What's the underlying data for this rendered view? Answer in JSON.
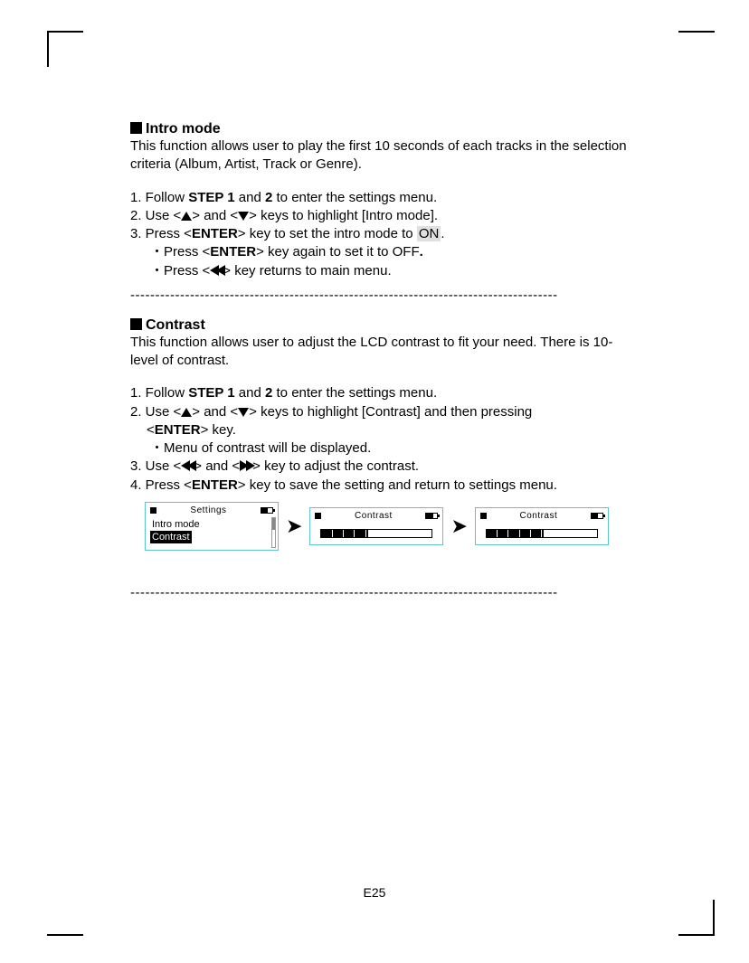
{
  "section1": {
    "heading": "Intro mode",
    "desc": "This function allows user to play the first 10 seconds of each tracks in the selection criteria (Album, Artist, Track or Genre).",
    "step1_a": "1. Follow ",
    "step1_b": "STEP 1",
    "step1_c": " and ",
    "step1_d": "2",
    "step1_e": " to enter the settings menu.",
    "step2_a": "2. Use <",
    "step2_b": "> and <",
    "step2_c": "> keys to highlight [Intro mode].",
    "step3_a": "3. Press <",
    "step3_b": "ENTER",
    "step3_c": "> key to set the intro mode to ",
    "step3_d": "ON",
    "step3_e": ".",
    "sub1_a": "・Press <",
    "sub1_b": "ENTER",
    "sub1_c": "> key again to set it to OFF",
    "sub1_d": ".",
    "sub2_a": "・Press <",
    "sub2_b": "> key returns to main menu."
  },
  "section2": {
    "heading": "Contrast",
    "desc": "This function allows user to adjust the LCD contrast to fit your need. There is 10-level of contrast.",
    "step1_a": "1. Follow ",
    "step1_b": "STEP 1",
    "step1_c": " and ",
    "step1_d": "2",
    "step1_e": " to enter the settings menu.",
    "step2_a": "2. Use <",
    "step2_b": "> and <",
    "step2_c": "> keys to highlight [Contrast] and then pressing",
    "step2_d": "<",
    "step2_e": "ENTER",
    "step2_f": "> key.",
    "sub1": "・Menu of contrast will be displayed.",
    "step3_a": "3. Use <",
    "step3_b": "> and <",
    "step3_c": "> key to adjust the contrast.",
    "step4_a": "4. Press <",
    "step4_b": "ENTER",
    "step4_c": "> key to save the setting and return to settings menu."
  },
  "screens": {
    "s1_title": "Settings",
    "s1_item1": "Intro mode",
    "s1_item2": "Contrast",
    "s2_title": "Contrast",
    "s3_title": "Contrast"
  },
  "separator": "--------------------------------------------------------------------------------------",
  "page_number": "E25"
}
